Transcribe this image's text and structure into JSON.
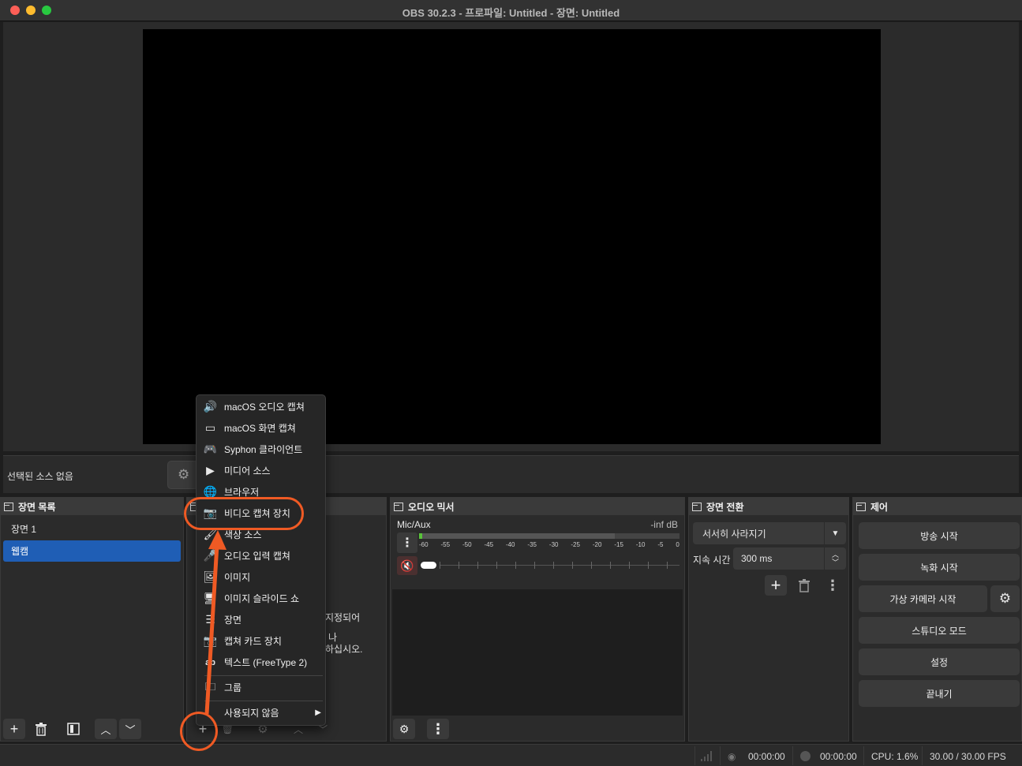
{
  "window": {
    "title": "OBS 30.2.3 - 프로파일: Untitled - 장면: Untitled"
  },
  "source_toolbar": {
    "no_source": "선택된 소스 없음"
  },
  "scenes": {
    "title": "장면 목록",
    "items": [
      {
        "label": "장면 1",
        "selected": false
      },
      {
        "label": "웹캠",
        "selected": true
      }
    ]
  },
  "sources": {
    "hint_line1": "지정되어",
    "hint_line2": "나",
    "hint_line3": "하십시오."
  },
  "mixer": {
    "title": "오디오 믹서",
    "channel": "Mic/Aux",
    "level": "-inf dB",
    "scale": [
      "-60",
      "-55",
      "-50",
      "-45",
      "-40",
      "-35",
      "-30",
      "-25",
      "-20",
      "-15",
      "-10",
      "-5",
      "0"
    ]
  },
  "transitions": {
    "title": "장면 전환",
    "selected": "서서히 사라지기",
    "duration_label": "지속 시간",
    "duration_value": "300 ms"
  },
  "controls": {
    "title": "제어",
    "start_stream": "방송 시작",
    "start_record": "녹화 시작",
    "start_vcam": "가상 카메라 시작",
    "studio_mode": "스튜디오 모드",
    "settings": "설정",
    "exit": "끝내기"
  },
  "statusbar": {
    "stream_time": "00:00:00",
    "record_time": "00:00:00",
    "cpu": "CPU: 1.6%",
    "fps": "30.00 / 30.00 FPS"
  },
  "context_menu": {
    "items": [
      {
        "label": "macOS 오디오 캡쳐",
        "icon": "speaker-icon"
      },
      {
        "label": "macOS 화면 캡쳐",
        "icon": "monitor-icon"
      },
      {
        "label": "Syphon 클라이언트",
        "icon": "gamepad-icon"
      },
      {
        "label": "미디어 소스",
        "icon": "play-icon"
      },
      {
        "label": "브라우저",
        "icon": "globe-icon"
      },
      {
        "label": "비디오 캡쳐 장치",
        "icon": "camera-icon",
        "highlighted": true
      },
      {
        "label": "색상 소스",
        "icon": "brush-icon"
      },
      {
        "label": "오디오 입력 캡쳐",
        "icon": "microphone-icon"
      },
      {
        "label": "이미지",
        "icon": "image-icon"
      },
      {
        "label": "이미지 슬라이드 쇼",
        "icon": "slideshow-icon"
      },
      {
        "label": "장면",
        "icon": "list-icon"
      },
      {
        "label": "캡쳐 카드 장치",
        "icon": "camera-icon"
      },
      {
        "label": "텍스트 (FreeType 2)",
        "icon": "text-icon"
      },
      {
        "label": "그룹",
        "icon": "folder-icon"
      },
      {
        "label": "사용되지 않음",
        "icon": "submenu-arrow-icon"
      }
    ]
  },
  "colors": {
    "accent": "#1f5eb5",
    "annotation": "#ef5a24",
    "meter_green": "#59c33a",
    "mute_red": "#d94b3c"
  }
}
